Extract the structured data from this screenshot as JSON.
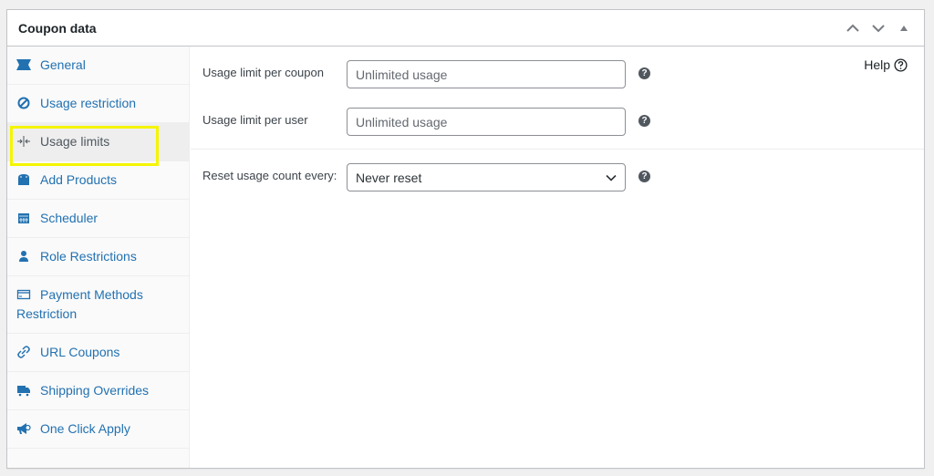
{
  "panel": {
    "title": "Coupon data",
    "controls": [
      {
        "name": "move-up-button",
        "icon": "chevron-up-icon"
      },
      {
        "name": "move-down-button",
        "icon": "chevron-down-icon"
      },
      {
        "name": "toggle-panel-button",
        "icon": "triangle-up-icon"
      }
    ]
  },
  "sidebar": {
    "items": [
      {
        "label": "General",
        "icon": "ticket-icon",
        "active": false
      },
      {
        "label": "Usage restriction",
        "icon": "block-icon",
        "active": false
      },
      {
        "label": "Usage limits",
        "icon": "limits-icon",
        "active": true
      },
      {
        "label": "Add Products",
        "icon": "bag-icon",
        "active": false
      },
      {
        "label": "Scheduler",
        "icon": "calendar-icon",
        "active": false
      },
      {
        "label": "Role Restrictions",
        "icon": "user-icon",
        "active": false
      },
      {
        "label": "Payment Methods Restriction",
        "icon": "credit-card-icon",
        "active": false
      },
      {
        "label": "URL Coupons",
        "icon": "link-icon",
        "active": false
      },
      {
        "label": "Shipping Overrides",
        "icon": "truck-icon",
        "active": false
      },
      {
        "label": "One Click Apply",
        "icon": "megaphone-icon",
        "active": false
      }
    ]
  },
  "main": {
    "help_label": "Help",
    "fields": [
      {
        "label": "Usage limit per coupon",
        "value": "",
        "placeholder": "Unlimited usage"
      },
      {
        "label": "Usage limit per user",
        "value": "",
        "placeholder": "Unlimited usage"
      }
    ],
    "reset": {
      "label": "Reset usage count every:",
      "selected": "Never reset"
    }
  },
  "colors": {
    "link": "#2271b1",
    "highlight": "#f5f500",
    "active_bg": "#eeeeee"
  }
}
